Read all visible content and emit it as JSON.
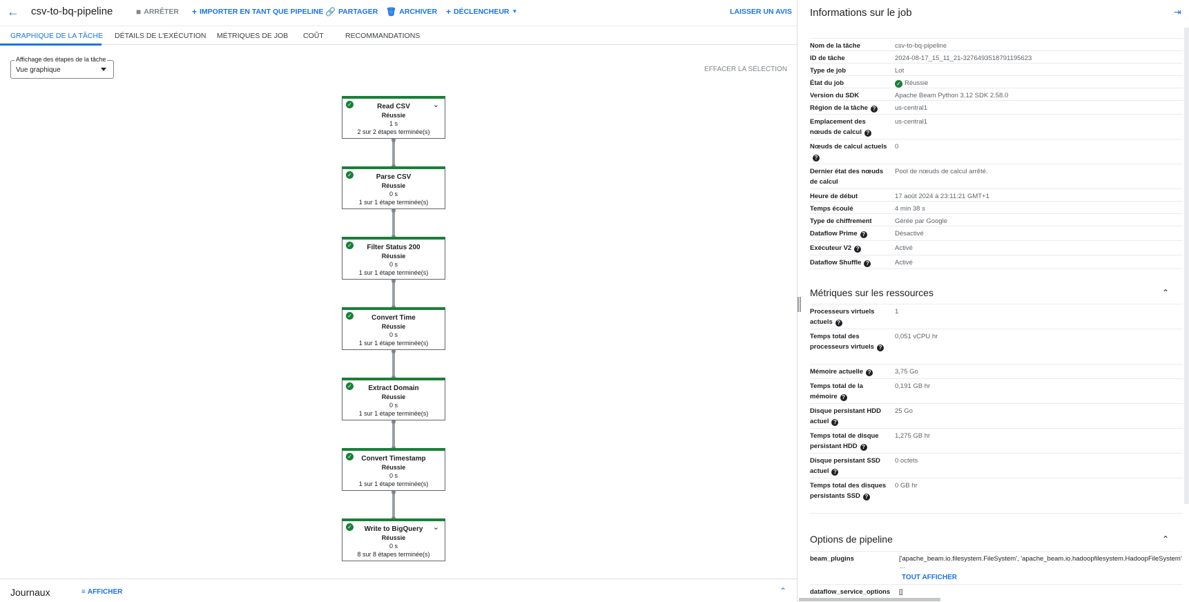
{
  "toolbar": {
    "job_name": "csv-to-bq-pipeline",
    "stop_label": "ARRÊTER",
    "import_label": "IMPORTER EN TANT QUE PIPELINE",
    "share_label": "PARTAGER",
    "archive_label": "ARCHIVER",
    "trigger_label": "DÉCLENCHEUR",
    "feedback_label": "LAISSER UN AVIS"
  },
  "tabs": [
    {
      "label": "GRAPHIQUE DE LA TÂCHE",
      "active": true
    },
    {
      "label": "DÉTAILS DE L'EXÉCUTION"
    },
    {
      "label": "MÉTRIQUES DE JOB"
    },
    {
      "label": "COÛT"
    },
    {
      "label": "RECOMMANDATIONS"
    }
  ],
  "stage_select": {
    "label": "Affichage des étapes de la tâche",
    "value": "Vue graphique"
  },
  "clear_selection": "EFFACER LA SÉLECTION",
  "graph": {
    "nodes": [
      {
        "title": "Read CSV",
        "status": "Réussie",
        "time": "1 s",
        "steps": "2 sur 2 étapes terminée(s)",
        "expandable": true
      },
      {
        "title": "Parse CSV",
        "status": "Réussie",
        "time": "0 s",
        "steps": "1 sur 1 étape terminée(s)",
        "expandable": false
      },
      {
        "title": "Filter Status 200",
        "status": "Réussie",
        "time": "0 s",
        "steps": "1 sur 1 étape terminée(s)",
        "expandable": false
      },
      {
        "title": "Convert Time",
        "status": "Réussie",
        "time": "0 s",
        "steps": "1 sur 1 étape terminée(s)",
        "expandable": false
      },
      {
        "title": "Extract Domain",
        "status": "Réussie",
        "time": "0 s",
        "steps": "1 sur 1 étape terminée(s)",
        "expandable": false
      },
      {
        "title": "Convert Timestamp",
        "status": "Réussie",
        "time": "0 s",
        "steps": "1 sur 1 étape terminée(s)",
        "expandable": false
      },
      {
        "title": "Write to BigQuery",
        "status": "Réussie",
        "time": "0 s",
        "steps": "8 sur 8 étapes terminée(s)",
        "expandable": true
      }
    ]
  },
  "logs": {
    "title": "Journaux",
    "show_label": "AFFICHER"
  },
  "panel": {
    "title": "Informations sur le job",
    "job_info": [
      {
        "key": "Nom de la tâche",
        "value": "csv-to-bq-pipeline"
      },
      {
        "key": "ID de tâche",
        "value": "2024-08-17_15_11_21-3276493518791195623"
      },
      {
        "key": "Type de job",
        "value": "Lot"
      },
      {
        "key": "État du job",
        "value": "Réussie",
        "status_ok": true
      },
      {
        "key": "Version du SDK",
        "value": "Apache Beam Python 3.12 SDK 2.58.0"
      },
      {
        "key": "Région de la tâche",
        "value": "us-central1",
        "help": true
      },
      {
        "key": "Emplacement des nœuds de calcul",
        "value": "us-central1",
        "help": true
      },
      {
        "key": "Nœuds de calcul actuels",
        "value": "0",
        "help": true
      },
      {
        "key": "Dernier état des nœuds de calcul",
        "value": "Pool de nœuds de calcul arrêté."
      },
      {
        "key": "Heure de début",
        "value": "17 août 2024 à 23:11:21 GMT+1"
      },
      {
        "key": "Temps écoulé",
        "value": "4 min 38 s"
      },
      {
        "key": "Type de chiffrement",
        "value": "Gérée par Google"
      },
      {
        "key": "Dataflow Prime",
        "value": "Désactivé",
        "help": true
      },
      {
        "key": "Exécuteur V2",
        "value": "Activé",
        "help": true
      },
      {
        "key": "Dataflow Shuffle",
        "value": "Activé",
        "help": true
      }
    ],
    "resources_title": "Métriques sur les ressources",
    "resources": [
      {
        "key": "Processeurs virtuels actuels",
        "value": "1",
        "help": true
      },
      {
        "key": "Temps total des processeurs virtuels",
        "value": "0,051 vCPU hr",
        "help": true
      },
      {
        "key": "Mémoire actuelle",
        "value": "3,75 Go",
        "help": true
      },
      {
        "key": "Temps total de la mémoire",
        "value": "0,191 GB hr",
        "help": true
      },
      {
        "key": "Disque persistant HDD actuel",
        "value": "25 Go",
        "help": true
      },
      {
        "key": "Temps total de disque persistant HDD",
        "value": "1,275 GB hr",
        "help": true
      },
      {
        "key": "Disque persistant SSD actuel",
        "value": "0 octets",
        "help": true
      },
      {
        "key": "Temps total des disques persistants SSD",
        "value": "0 GB hr",
        "help": true
      }
    ],
    "options_title": "Options de pipeline",
    "options": [
      {
        "key": "beam_plugins",
        "value": "['apache_beam.io.filesystem.FileSystem', 'apache_beam.io.hadoopfilesystem.HadoopFileSystem'",
        "ellipsis": "...",
        "show_all": "TOUT AFFICHER"
      },
      {
        "key": "dataflow_service_options",
        "value": "[]"
      }
    ]
  },
  "colors": {
    "accent": "#1a73e8",
    "success": "#188038",
    "muted": "#80868b"
  }
}
